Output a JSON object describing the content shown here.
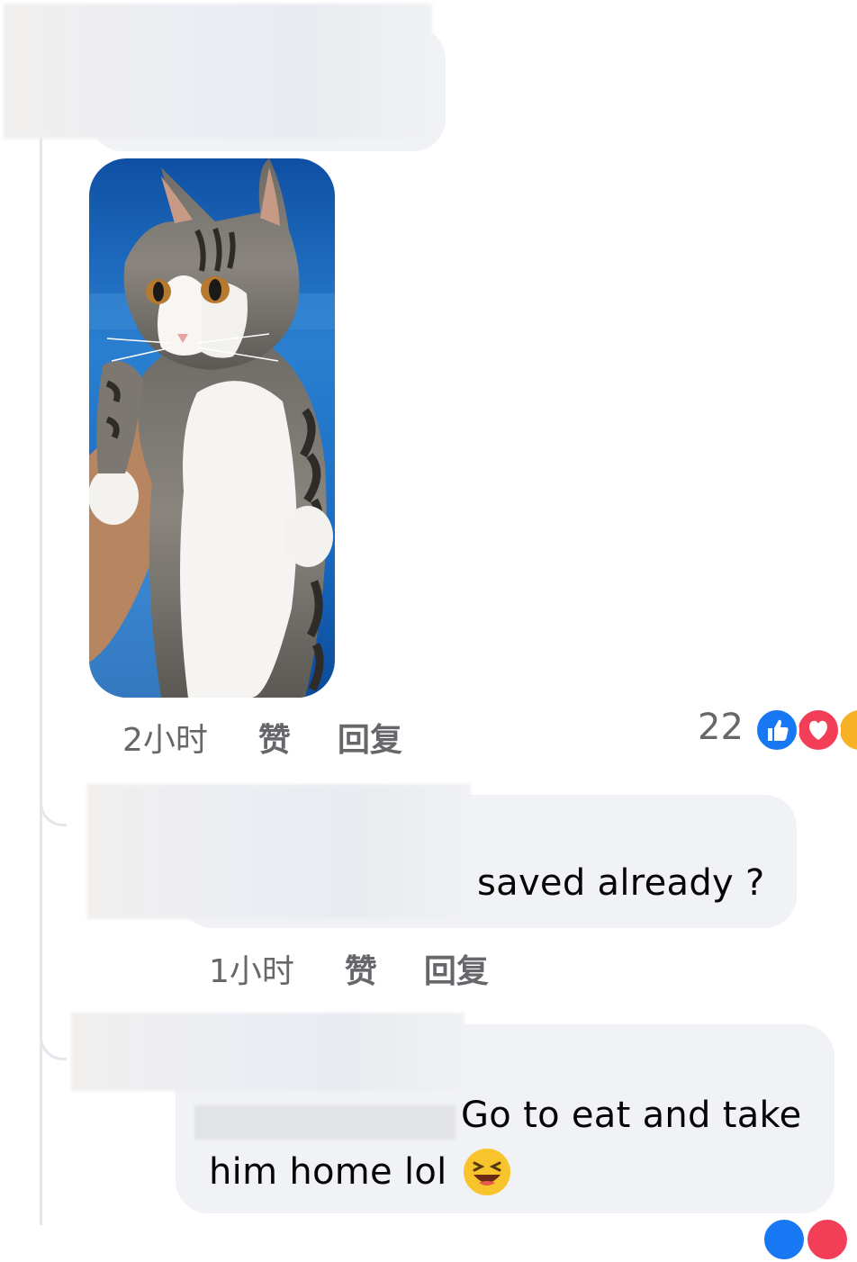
{
  "comment1": {
    "time": "2小时",
    "like_label": "赞",
    "reply_label": "回复",
    "reaction_count": "22",
    "reactions": [
      "like-icon",
      "love-icon",
      "haha-icon"
    ]
  },
  "comment2": {
    "text": "saved already ?",
    "time": "1小时",
    "like_label": "赞",
    "reply_label": "回复"
  },
  "comment3": {
    "text_line1": "Go to eat and take",
    "text_line2": "him home lol",
    "emoji": "😆"
  },
  "colors": {
    "bubble": "#f0f2f5",
    "meta_text": "#65676b",
    "like_blue": "#1877f2",
    "love_red": "#f33e58",
    "haha_yellow": "#f7b125"
  }
}
